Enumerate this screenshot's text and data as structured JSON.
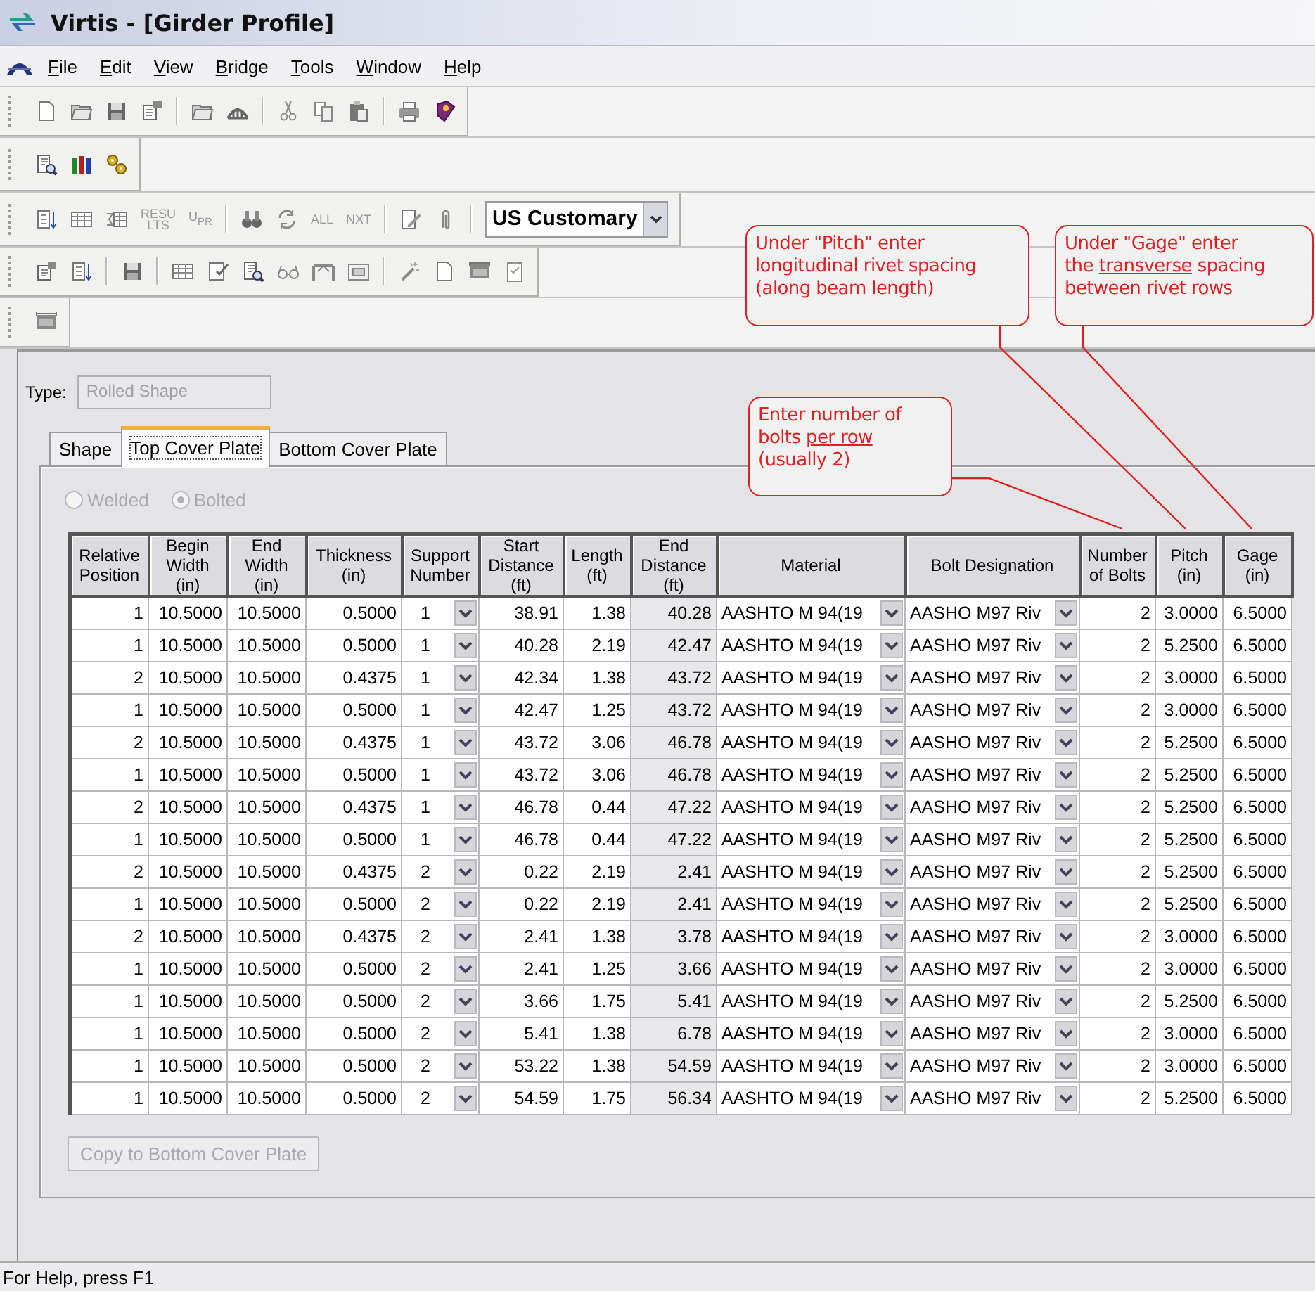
{
  "window": {
    "title": "Virtis - [Girder Profile]"
  },
  "menu": [
    "File",
    "Edit",
    "View",
    "Bridge",
    "Tools",
    "Window",
    "Help"
  ],
  "toolbars": [
    {
      "items": [
        {
          "kind": "icon"
        },
        {
          "kind": "icon"
        },
        {
          "kind": "icon"
        },
        {
          "kind": "icon"
        },
        {
          "kind": "separator"
        },
        {
          "kind": "icon"
        },
        {
          "kind": "icon"
        },
        {
          "kind": "separator"
        },
        {
          "kind": "icon"
        },
        {
          "kind": "icon"
        },
        {
          "kind": "icon"
        },
        {
          "kind": "separator"
        },
        {
          "kind": "icon"
        },
        {
          "kind": "icon"
        }
      ]
    },
    {
      "items": [
        {
          "kind": "icon"
        },
        {
          "kind": "icon"
        },
        {
          "kind": "icon"
        }
      ]
    },
    {
      "items": [
        {
          "kind": "icon"
        },
        {
          "kind": "icon"
        },
        {
          "kind": "icon"
        },
        {
          "kind": "text",
          "label": "RESU\nLTS"
        },
        {
          "kind": "text",
          "label": "U$_{P}$$_{R}$"
        },
        {
          "kind": "separator"
        },
        {
          "kind": "icon"
        },
        {
          "kind": "icon"
        },
        {
          "kind": "text",
          "label": "ALL"
        },
        {
          "kind": "text",
          "label": "NXT"
        },
        {
          "kind": "separator"
        },
        {
          "kind": "icon"
        },
        {
          "kind": "icon"
        },
        {
          "kind": "separator"
        },
        {
          "kind": "select",
          "value": "US Customary"
        }
      ]
    },
    {
      "items": [
        {
          "kind": "icon"
        },
        {
          "kind": "icon"
        },
        {
          "kind": "separator"
        },
        {
          "kind": "icon"
        },
        {
          "kind": "separator"
        },
        {
          "kind": "icon"
        },
        {
          "kind": "icon"
        },
        {
          "kind": "icon"
        },
        {
          "kind": "icon"
        },
        {
          "kind": "icon"
        },
        {
          "kind": "icon"
        },
        {
          "kind": "separator"
        },
        {
          "kind": "icon"
        },
        {
          "kind": "icon"
        },
        {
          "kind": "icon"
        },
        {
          "kind": "icon"
        }
      ]
    },
    {
      "items": [
        {
          "kind": "icon"
        }
      ]
    }
  ],
  "form": {
    "type_label": "Type:",
    "type_field": {
      "value": "Rolled Shape",
      "disabled": true
    },
    "tabs": [
      {
        "label": "Shape",
        "selected": false
      },
      {
        "label": "Top Cover Plate",
        "selected": true
      },
      {
        "label": "Bottom Cover Plate",
        "selected": false
      }
    ],
    "radios": [
      {
        "label": "Welded",
        "selected": false,
        "disabled": true
      },
      {
        "label": "Bolted",
        "selected": true,
        "disabled": true
      }
    ],
    "table": {
      "columns": [
        {
          "label": "Relative\nPosition",
          "kind": "number"
        },
        {
          "label": "Begin\nWidth\n(in)",
          "kind": "number"
        },
        {
          "label": "End\nWidth\n(in)",
          "kind": "number"
        },
        {
          "label": "Thickness\n(in)",
          "kind": "number"
        },
        {
          "label": "Support\nNumber",
          "kind": "select"
        },
        {
          "label": "Start\nDistance\n(ft)",
          "kind": "number"
        },
        {
          "label": "Length\n(ft)",
          "kind": "number"
        },
        {
          "label": "End\nDistance\n(ft)",
          "kind": "computed"
        },
        {
          "label": "Material",
          "kind": "select"
        },
        {
          "label": "Bolt Designation",
          "kind": "select"
        },
        {
          "label": "Number\nof Bolts",
          "kind": "number"
        },
        {
          "label": "Pitch\n(in)",
          "kind": "number"
        },
        {
          "label": "Gage\n(in)",
          "kind": "number"
        }
      ],
      "rows": [
        [
          "1",
          "10.5000",
          "10.5000",
          "0.5000",
          "1",
          "38.91",
          "1.38",
          "40.28",
          "AASHTO M 94(19",
          "AASHO M97 Riv",
          "2",
          "3.0000",
          "6.5000"
        ],
        [
          "1",
          "10.5000",
          "10.5000",
          "0.5000",
          "1",
          "40.28",
          "2.19",
          "42.47",
          "AASHTO M 94(19",
          "AASHO M97 Riv",
          "2",
          "5.2500",
          "6.5000"
        ],
        [
          "2",
          "10.5000",
          "10.5000",
          "0.4375",
          "1",
          "42.34",
          "1.38",
          "43.72",
          "AASHTO M 94(19",
          "AASHO M97 Riv",
          "2",
          "3.0000",
          "6.5000"
        ],
        [
          "1",
          "10.5000",
          "10.5000",
          "0.5000",
          "1",
          "42.47",
          "1.25",
          "43.72",
          "AASHTO M 94(19",
          "AASHO M97 Riv",
          "2",
          "3.0000",
          "6.5000"
        ],
        [
          "2",
          "10.5000",
          "10.5000",
          "0.4375",
          "1",
          "43.72",
          "3.06",
          "46.78",
          "AASHTO M 94(19",
          "AASHO M97 Riv",
          "2",
          "5.2500",
          "6.5000"
        ],
        [
          "1",
          "10.5000",
          "10.5000",
          "0.5000",
          "1",
          "43.72",
          "3.06",
          "46.78",
          "AASHTO M 94(19",
          "AASHO M97 Riv",
          "2",
          "5.2500",
          "6.5000"
        ],
        [
          "2",
          "10.5000",
          "10.5000",
          "0.4375",
          "1",
          "46.78",
          "0.44",
          "47.22",
          "AASHTO M 94(19",
          "AASHO M97 Riv",
          "2",
          "5.2500",
          "6.5000"
        ],
        [
          "1",
          "10.5000",
          "10.5000",
          "0.5000",
          "1",
          "46.78",
          "0.44",
          "47.22",
          "AASHTO M 94(19",
          "AASHO M97 Riv",
          "2",
          "5.2500",
          "6.5000"
        ],
        [
          "2",
          "10.5000",
          "10.5000",
          "0.4375",
          "2",
          "0.22",
          "2.19",
          "2.41",
          "AASHTO M 94(19",
          "AASHO M97 Riv",
          "2",
          "5.2500",
          "6.5000"
        ],
        [
          "1",
          "10.5000",
          "10.5000",
          "0.5000",
          "2",
          "0.22",
          "2.19",
          "2.41",
          "AASHTO M 94(19",
          "AASHO M97 Riv",
          "2",
          "5.2500",
          "6.5000"
        ],
        [
          "2",
          "10.5000",
          "10.5000",
          "0.4375",
          "2",
          "2.41",
          "1.38",
          "3.78",
          "AASHTO M 94(19",
          "AASHO M97 Riv",
          "2",
          "3.0000",
          "6.5000"
        ],
        [
          "1",
          "10.5000",
          "10.5000",
          "0.5000",
          "2",
          "2.41",
          "1.25",
          "3.66",
          "AASHTO M 94(19",
          "AASHO M97 Riv",
          "2",
          "3.0000",
          "6.5000"
        ],
        [
          "1",
          "10.5000",
          "10.5000",
          "0.5000",
          "2",
          "3.66",
          "1.75",
          "5.41",
          "AASHTO M 94(19",
          "AASHO M97 Riv",
          "2",
          "5.2500",
          "6.5000"
        ],
        [
          "1",
          "10.5000",
          "10.5000",
          "0.5000",
          "2",
          "5.41",
          "1.38",
          "6.78",
          "AASHTO M 94(19",
          "AASHO M97 Riv",
          "2",
          "3.0000",
          "6.5000"
        ],
        [
          "1",
          "10.5000",
          "10.5000",
          "0.5000",
          "2",
          "53.22",
          "1.38",
          "54.59",
          "AASHTO M 94(19",
          "AASHO M97 Riv",
          "2",
          "3.0000",
          "6.5000"
        ],
        [
          "1",
          "10.5000",
          "10.5000",
          "0.5000",
          "2",
          "54.59",
          "1.75",
          "56.34",
          "AASHTO M 94(19",
          "AASHO M97 Riv",
          "2",
          "5.2500",
          "6.5000"
        ]
      ]
    },
    "copy_button": {
      "label": "Copy to Bottom Cover Plate",
      "disabled": true
    }
  },
  "callouts": [
    {
      "segments": [
        {
          "text": "Under \"Pitch\" enter\nlongitudinal rivet spacing\n(along beam length)",
          "underline": false
        }
      ]
    },
    {
      "segments": [
        {
          "text": "Under \"Gage\" enter\nthe ",
          "underline": false
        },
        {
          "text": "transverse",
          "underline": true
        },
        {
          "text": " spacing\nbetween rivet rows",
          "underline": false
        }
      ]
    },
    {
      "segments": [
        {
          "text": "Enter number of\nbolts ",
          "underline": false
        },
        {
          "text": "per row",
          "underline": true
        },
        {
          "text": "\n(usually 2)",
          "underline": false
        }
      ]
    }
  ],
  "status_bar": "For Help, press F1"
}
